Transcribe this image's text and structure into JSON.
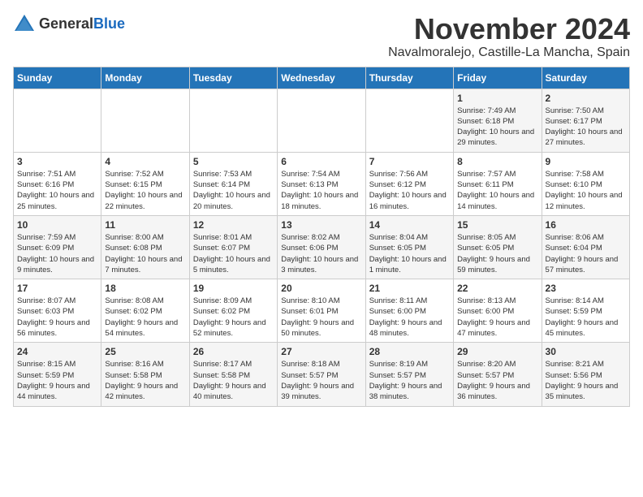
{
  "logo": {
    "general": "General",
    "blue": "Blue"
  },
  "title": "November 2024",
  "subtitle": "Navalmoralejo, Castille-La Mancha, Spain",
  "weekdays": [
    "Sunday",
    "Monday",
    "Tuesday",
    "Wednesday",
    "Thursday",
    "Friday",
    "Saturday"
  ],
  "weeks": [
    [
      {
        "day": "",
        "info": ""
      },
      {
        "day": "",
        "info": ""
      },
      {
        "day": "",
        "info": ""
      },
      {
        "day": "",
        "info": ""
      },
      {
        "day": "",
        "info": ""
      },
      {
        "day": "1",
        "info": "Sunrise: 7:49 AM\nSunset: 6:18 PM\nDaylight: 10 hours and 29 minutes."
      },
      {
        "day": "2",
        "info": "Sunrise: 7:50 AM\nSunset: 6:17 PM\nDaylight: 10 hours and 27 minutes."
      }
    ],
    [
      {
        "day": "3",
        "info": "Sunrise: 7:51 AM\nSunset: 6:16 PM\nDaylight: 10 hours and 25 minutes."
      },
      {
        "day": "4",
        "info": "Sunrise: 7:52 AM\nSunset: 6:15 PM\nDaylight: 10 hours and 22 minutes."
      },
      {
        "day": "5",
        "info": "Sunrise: 7:53 AM\nSunset: 6:14 PM\nDaylight: 10 hours and 20 minutes."
      },
      {
        "day": "6",
        "info": "Sunrise: 7:54 AM\nSunset: 6:13 PM\nDaylight: 10 hours and 18 minutes."
      },
      {
        "day": "7",
        "info": "Sunrise: 7:56 AM\nSunset: 6:12 PM\nDaylight: 10 hours and 16 minutes."
      },
      {
        "day": "8",
        "info": "Sunrise: 7:57 AM\nSunset: 6:11 PM\nDaylight: 10 hours and 14 minutes."
      },
      {
        "day": "9",
        "info": "Sunrise: 7:58 AM\nSunset: 6:10 PM\nDaylight: 10 hours and 12 minutes."
      }
    ],
    [
      {
        "day": "10",
        "info": "Sunrise: 7:59 AM\nSunset: 6:09 PM\nDaylight: 10 hours and 9 minutes."
      },
      {
        "day": "11",
        "info": "Sunrise: 8:00 AM\nSunset: 6:08 PM\nDaylight: 10 hours and 7 minutes."
      },
      {
        "day": "12",
        "info": "Sunrise: 8:01 AM\nSunset: 6:07 PM\nDaylight: 10 hours and 5 minutes."
      },
      {
        "day": "13",
        "info": "Sunrise: 8:02 AM\nSunset: 6:06 PM\nDaylight: 10 hours and 3 minutes."
      },
      {
        "day": "14",
        "info": "Sunrise: 8:04 AM\nSunset: 6:05 PM\nDaylight: 10 hours and 1 minute."
      },
      {
        "day": "15",
        "info": "Sunrise: 8:05 AM\nSunset: 6:05 PM\nDaylight: 9 hours and 59 minutes."
      },
      {
        "day": "16",
        "info": "Sunrise: 8:06 AM\nSunset: 6:04 PM\nDaylight: 9 hours and 57 minutes."
      }
    ],
    [
      {
        "day": "17",
        "info": "Sunrise: 8:07 AM\nSunset: 6:03 PM\nDaylight: 9 hours and 56 minutes."
      },
      {
        "day": "18",
        "info": "Sunrise: 8:08 AM\nSunset: 6:02 PM\nDaylight: 9 hours and 54 minutes."
      },
      {
        "day": "19",
        "info": "Sunrise: 8:09 AM\nSunset: 6:02 PM\nDaylight: 9 hours and 52 minutes."
      },
      {
        "day": "20",
        "info": "Sunrise: 8:10 AM\nSunset: 6:01 PM\nDaylight: 9 hours and 50 minutes."
      },
      {
        "day": "21",
        "info": "Sunrise: 8:11 AM\nSunset: 6:00 PM\nDaylight: 9 hours and 48 minutes."
      },
      {
        "day": "22",
        "info": "Sunrise: 8:13 AM\nSunset: 6:00 PM\nDaylight: 9 hours and 47 minutes."
      },
      {
        "day": "23",
        "info": "Sunrise: 8:14 AM\nSunset: 5:59 PM\nDaylight: 9 hours and 45 minutes."
      }
    ],
    [
      {
        "day": "24",
        "info": "Sunrise: 8:15 AM\nSunset: 5:59 PM\nDaylight: 9 hours and 44 minutes."
      },
      {
        "day": "25",
        "info": "Sunrise: 8:16 AM\nSunset: 5:58 PM\nDaylight: 9 hours and 42 minutes."
      },
      {
        "day": "26",
        "info": "Sunrise: 8:17 AM\nSunset: 5:58 PM\nDaylight: 9 hours and 40 minutes."
      },
      {
        "day": "27",
        "info": "Sunrise: 8:18 AM\nSunset: 5:57 PM\nDaylight: 9 hours and 39 minutes."
      },
      {
        "day": "28",
        "info": "Sunrise: 8:19 AM\nSunset: 5:57 PM\nDaylight: 9 hours and 38 minutes."
      },
      {
        "day": "29",
        "info": "Sunrise: 8:20 AM\nSunset: 5:57 PM\nDaylight: 9 hours and 36 minutes."
      },
      {
        "day": "30",
        "info": "Sunrise: 8:21 AM\nSunset: 5:56 PM\nDaylight: 9 hours and 35 minutes."
      }
    ]
  ]
}
